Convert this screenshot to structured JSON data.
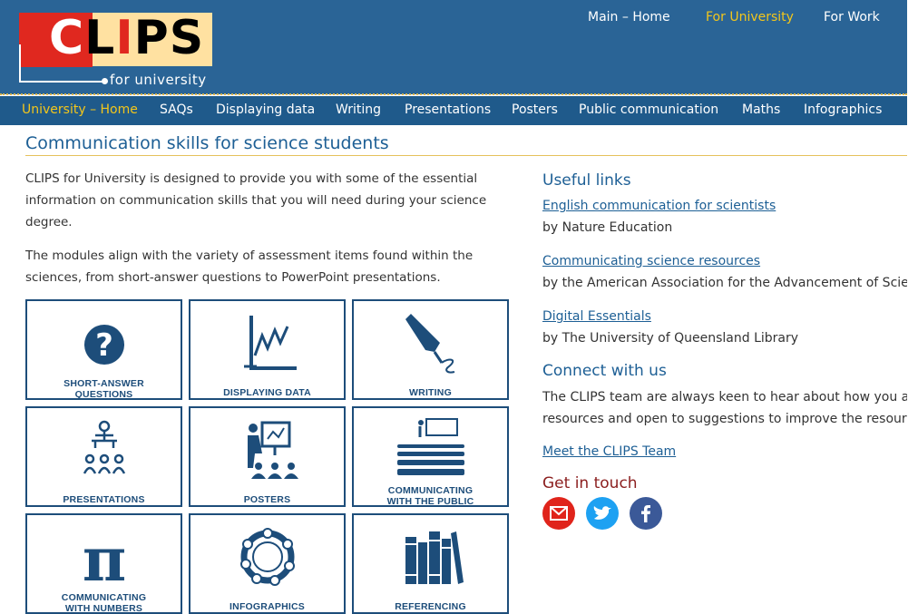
{
  "logo": {
    "letters": [
      "C",
      "L",
      "I",
      "P",
      "S"
    ],
    "subtitle": "for university"
  },
  "top_nav": [
    {
      "label": "Main – Home",
      "active": false
    },
    {
      "label": "For University",
      "active": true
    },
    {
      "label": "For Work",
      "active": false
    }
  ],
  "main_nav": [
    {
      "label": "University – Home",
      "active": true
    },
    {
      "label": "SAQs"
    },
    {
      "label": "Displaying data"
    },
    {
      "label": "Writing"
    },
    {
      "label": "Presentations"
    },
    {
      "label": "Posters"
    },
    {
      "label": "Public communication"
    },
    {
      "label": "Maths"
    },
    {
      "label": "Infographics"
    }
  ],
  "page_title": "Communication skills for science students",
  "intro": [
    "CLIPS for University is designed to provide you with some of the essential information on communication skills that you will need during your science degree.",
    "The modules align with the variety of assessment items found within the sciences, from short-answer questions to PowerPoint presentations."
  ],
  "tiles": [
    {
      "label_lines": [
        "SHORT-ANSWER",
        "QUESTIONS"
      ],
      "icon": "question-icon"
    },
    {
      "label_lines": [
        "DISPLAYING DATA"
      ],
      "icon": "line-graph-icon"
    },
    {
      "label_lines": [
        "WRITING"
      ],
      "icon": "fountain-pen-icon"
    },
    {
      "label_lines": [
        "PRESENTATIONS"
      ],
      "icon": "presenter-audience-icon"
    },
    {
      "label_lines": [
        "POSTERS"
      ],
      "icon": "poster-board-icon"
    },
    {
      "label_lines": [
        "COMMUNICATING",
        "WITH THE PUBLIC"
      ],
      "icon": "crowd-icon"
    },
    {
      "label_lines": [
        "COMMUNICATING",
        "WITH NUMBERS"
      ],
      "icon": "pi-icon"
    },
    {
      "label_lines": [
        "INFOGRAPHICS"
      ],
      "icon": "infographic-ring-icon"
    },
    {
      "label_lines": [
        "REFERENCING"
      ],
      "icon": "books-icon"
    }
  ],
  "useful_links": {
    "heading": "Useful links",
    "items": [
      {
        "title": "English communication for scientists",
        "by": "by Nature Education"
      },
      {
        "title": "Communicating science resources",
        "by": "by the American Association for the Advancement of Scie"
      },
      {
        "title": "Digital Essentials",
        "by": "by The University of Queensland Library"
      }
    ]
  },
  "connect": {
    "heading": "Connect with us",
    "lines": [
      "The CLIPS team are always keen to hear about how you a",
      "resources and open to suggestions to improve the resour"
    ],
    "team_link": "Meet the CLIPS Team",
    "get_in_touch": "Get in touch"
  },
  "social": [
    {
      "name": "email-icon",
      "color": "#e0241b"
    },
    {
      "name": "twitter-icon",
      "color": "#1da1f2"
    },
    {
      "name": "facebook-icon",
      "color": "#3b5998"
    }
  ],
  "colors": {
    "header": "#2a6496",
    "nav": "#1f5a8b",
    "accent": "#f3c61b",
    "title": "#1d5f95",
    "tile_border": "#1d4d7a"
  }
}
